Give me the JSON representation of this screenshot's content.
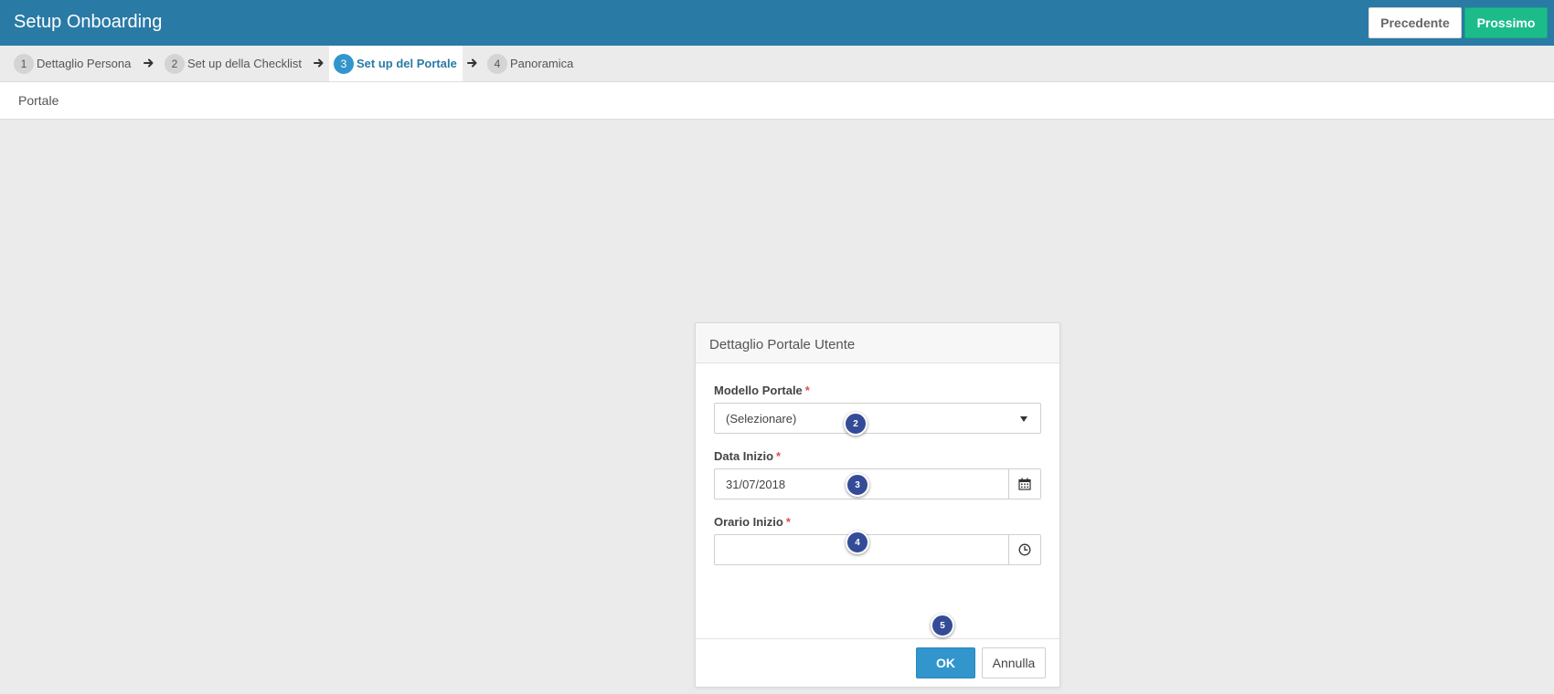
{
  "header": {
    "title": "Setup Onboarding",
    "prev_label": "Precedente",
    "next_label": "Prossimo"
  },
  "steps": [
    {
      "num": "1",
      "label": "Dettaglio Persona",
      "active": false
    },
    {
      "num": "2",
      "label": "Set up della Checklist",
      "active": false
    },
    {
      "num": "3",
      "label": "Set up del Portale",
      "active": true
    },
    {
      "num": "4",
      "label": "Panoramica",
      "active": false
    }
  ],
  "section": {
    "title": "Portale"
  },
  "dialog": {
    "title": "Dettaglio Portale Utente",
    "fields": {
      "template": {
        "label": "Modello Portale",
        "required": "*",
        "value": "(Selezionare)"
      },
      "start_date": {
        "label": "Data Inizio",
        "required": "*",
        "value": "31/07/2018"
      },
      "start_time": {
        "label": "Orario Inizio",
        "required": "*",
        "value": ""
      }
    },
    "ok_label": "OK",
    "cancel_label": "Annulla"
  },
  "callouts": [
    "2",
    "3",
    "4",
    "5"
  ],
  "colors": {
    "header_bg": "#2a7aa6",
    "next_button": "#1bbc8a",
    "ok_button": "#3296cd",
    "active_step": "#3296cd",
    "callout": "#344c97",
    "required": "#d9534f"
  },
  "icons": {
    "step_separator": "arrow-right-icon",
    "select_toggle": "caret-down-icon",
    "date_picker": "calendar-icon",
    "time_picker": "clock-icon"
  }
}
